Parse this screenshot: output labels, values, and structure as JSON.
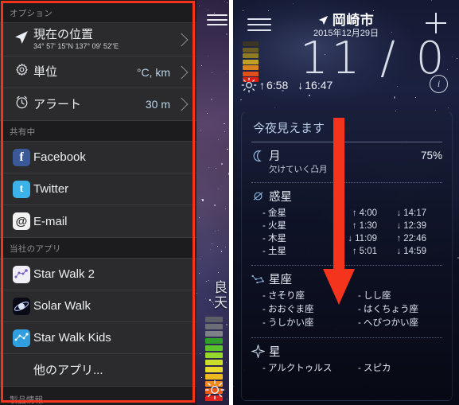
{
  "left_panel": {
    "groups": [
      {
        "header": "オプション",
        "items": [
          {
            "name": "current-location",
            "icon": "location-arrow-icon",
            "label": "現在の位置",
            "sub": "34° 57' 15\"N 137° 09' 52\"E",
            "value": "",
            "chevron": true
          },
          {
            "name": "units",
            "icon": "gear-icon",
            "label": "単位",
            "sub": "",
            "value": "°C, km",
            "chevron": true
          },
          {
            "name": "alert",
            "icon": "alarm-clock-icon",
            "label": "アラート",
            "sub": "",
            "value": "30 m",
            "chevron": true
          }
        ]
      },
      {
        "header": "共有中",
        "items": [
          {
            "name": "facebook",
            "icon": "facebook-icon",
            "label": "Facebook",
            "sub": "",
            "value": "",
            "chevron": false
          },
          {
            "name": "twitter",
            "icon": "twitter-icon",
            "label": "Twitter",
            "sub": "",
            "value": "",
            "chevron": false
          },
          {
            "name": "email",
            "icon": "email-at-icon",
            "label": "E-mail",
            "sub": "",
            "value": "",
            "chevron": false
          }
        ]
      },
      {
        "header": "当社のアプリ",
        "items": [
          {
            "name": "star-walk-2",
            "icon": "star-walk-2-icon",
            "label": "Star Walk 2",
            "sub": "",
            "value": "",
            "chevron": false
          },
          {
            "name": "solar-walk",
            "icon": "solar-walk-icon",
            "label": "Solar Walk",
            "sub": "",
            "value": "",
            "chevron": false
          },
          {
            "name": "star-walk-kids",
            "icon": "star-walk-kids-icon",
            "label": "Star Walk Kids",
            "sub": "",
            "value": "",
            "chevron": false
          },
          {
            "name": "other-apps",
            "icon": "",
            "label": "他のアプリ...",
            "sub": "",
            "value": "",
            "chevron": false
          }
        ]
      }
    ],
    "footer_header": "製品情報",
    "background_overlay": {
      "vertical_text": "良\n天",
      "ladder_colors": [
        "#5c6066",
        "#6b6f75",
        "#7d8188",
        "#2f9e2a",
        "#5cc32d",
        "#93d82b",
        "#c9dd2a",
        "#e8d92a",
        "#f0b81f",
        "#f08a1c",
        "#ec5a18",
        "#e0231a"
      ]
    }
  },
  "right_panel": {
    "header": {
      "title": "岡崎市",
      "date": "2015年12月29日",
      "temps": "11 / 0",
      "sunrise": "6:58",
      "sunset": "16:47",
      "sunrise_arrow": "↑",
      "sunset_arrow": "↓",
      "ladder_colors": [
        "#3a3524",
        "#6a5c22",
        "#8f7c22",
        "#bfa024",
        "#d9801f",
        "#e0501a",
        "#da2016"
      ]
    },
    "card": {
      "title": "今夜見えます",
      "moon": {
        "name": "月",
        "phase": "欠けていく凸月",
        "illumination": "75%",
        "icon": "crescent-moon-icon"
      },
      "planets": {
        "name": "惑星",
        "icon": "planet-icon",
        "rows": [
          {
            "label": "- 金星",
            "t1_arrow": "↑",
            "t1": "4:00",
            "t2_arrow": "↓",
            "t2": "14:17"
          },
          {
            "label": "- 火星",
            "t1_arrow": "↑",
            "t1": "1:30",
            "t2_arrow": "↓",
            "t2": "12:39"
          },
          {
            "label": "- 木星",
            "t1_arrow": "↓",
            "t1": "11:09",
            "t2_arrow": "↑",
            "t2": "22:46"
          },
          {
            "label": "- 土星",
            "t1_arrow": "↑",
            "t1": "5:01",
            "t2_arrow": "↓",
            "t2": "14:59"
          }
        ]
      },
      "constellations": {
        "name": "星座",
        "icon": "constellation-icon",
        "items": [
          "- さそり座",
          "- しし座",
          "- おおぐま座",
          "- はくちょう座",
          "- うしかい座",
          "- へびつかい座"
        ]
      },
      "stars": {
        "name": "星",
        "icon": "sparkle-star-icon",
        "items": [
          "- アルクトゥルス",
          "- スピカ"
        ]
      }
    }
  },
  "annotations": {
    "highlight_box_color": "#f4341c",
    "arrow_color": "#f4341c"
  }
}
